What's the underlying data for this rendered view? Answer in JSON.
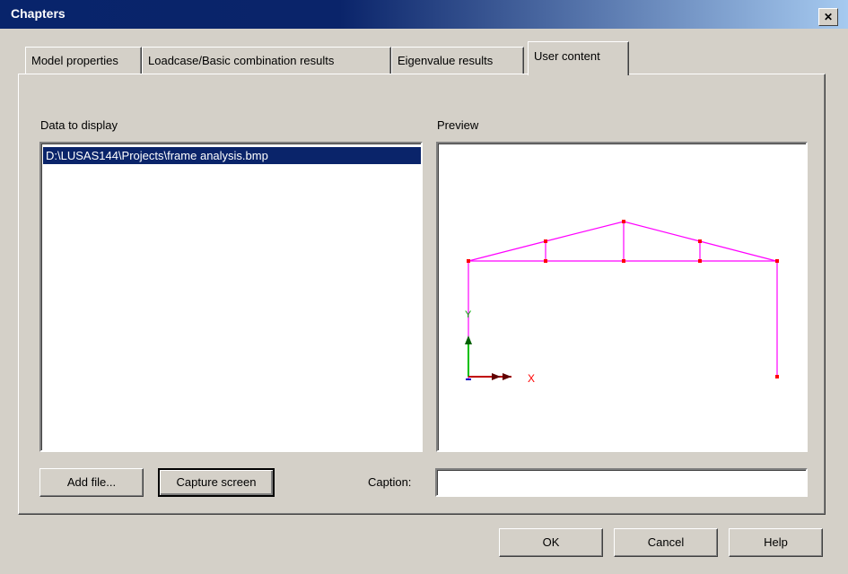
{
  "dialog": {
    "title": "Chapters",
    "close_glyph": "✕"
  },
  "tabs": [
    {
      "label": "Model properties"
    },
    {
      "label": "Loadcase/Basic combination results"
    },
    {
      "label": "Eigenvalue results"
    },
    {
      "label": "User content",
      "active": true
    }
  ],
  "data_panel": {
    "label": "Data to display",
    "items": [
      "D:\\LUSAS144\\Projects\\frame analysis.bmp"
    ],
    "selected_index": 0
  },
  "preview": {
    "label": "Preview",
    "axis_labels": {
      "x": "X",
      "y": "Y"
    },
    "colors": {
      "frame": "#ff00ff",
      "nodes": "#ff0000",
      "x_axis": "#c00000",
      "y_axis": "#00c000",
      "z_axis": "#0000c0"
    }
  },
  "buttons": {
    "add_file": "Add file...",
    "capture_screen": "Capture screen",
    "ok": "OK",
    "cancel": "Cancel",
    "help": "Help"
  },
  "caption": {
    "label": "Caption:",
    "value": ""
  }
}
